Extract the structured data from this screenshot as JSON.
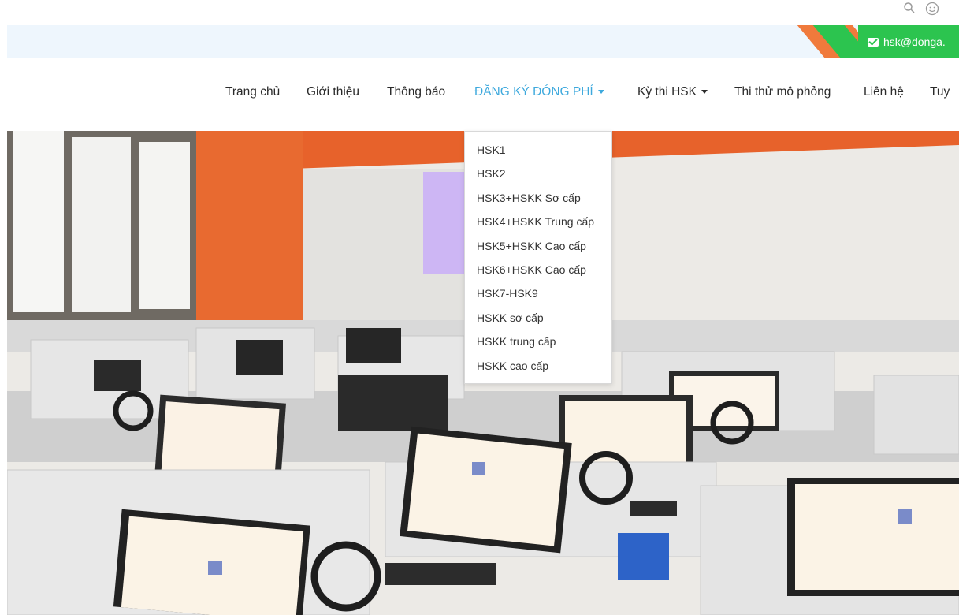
{
  "header": {
    "email": "hsk@donga.",
    "colors": {
      "green": "#2cc44f",
      "orange": "#f07a3c",
      "bar": "#eef6fd"
    }
  },
  "top_icons": [
    "search-icon",
    "smiley-icon"
  ],
  "nav": {
    "items": [
      {
        "label": "Trang chủ"
      },
      {
        "label": "Giới thiệu"
      },
      {
        "label": "Thông báo"
      },
      {
        "label": "ĐĂNG KÝ ĐÓNG PHÍ",
        "active": true,
        "has_caret": true
      },
      {
        "label": "Kỳ thi HSK",
        "has_caret": true
      },
      {
        "label": "Thi thử mô phỏng"
      },
      {
        "label": "Liên hệ"
      },
      {
        "label": "Tuy"
      }
    ],
    "active_color": "#3ea9dd"
  },
  "dropdown": {
    "items": [
      "HSK1",
      "HSK2",
      "HSK3+HSKK Sơ cấp",
      "HSK4+HSKK Trung cấp",
      "HSK5+HSKK Cao cấp",
      "HSK6+HSKK Cao cấp",
      "HSK7-HSK9",
      "HSKK sơ cấp",
      "HSKK trung cấp",
      "HSKK cao cấp"
    ]
  }
}
